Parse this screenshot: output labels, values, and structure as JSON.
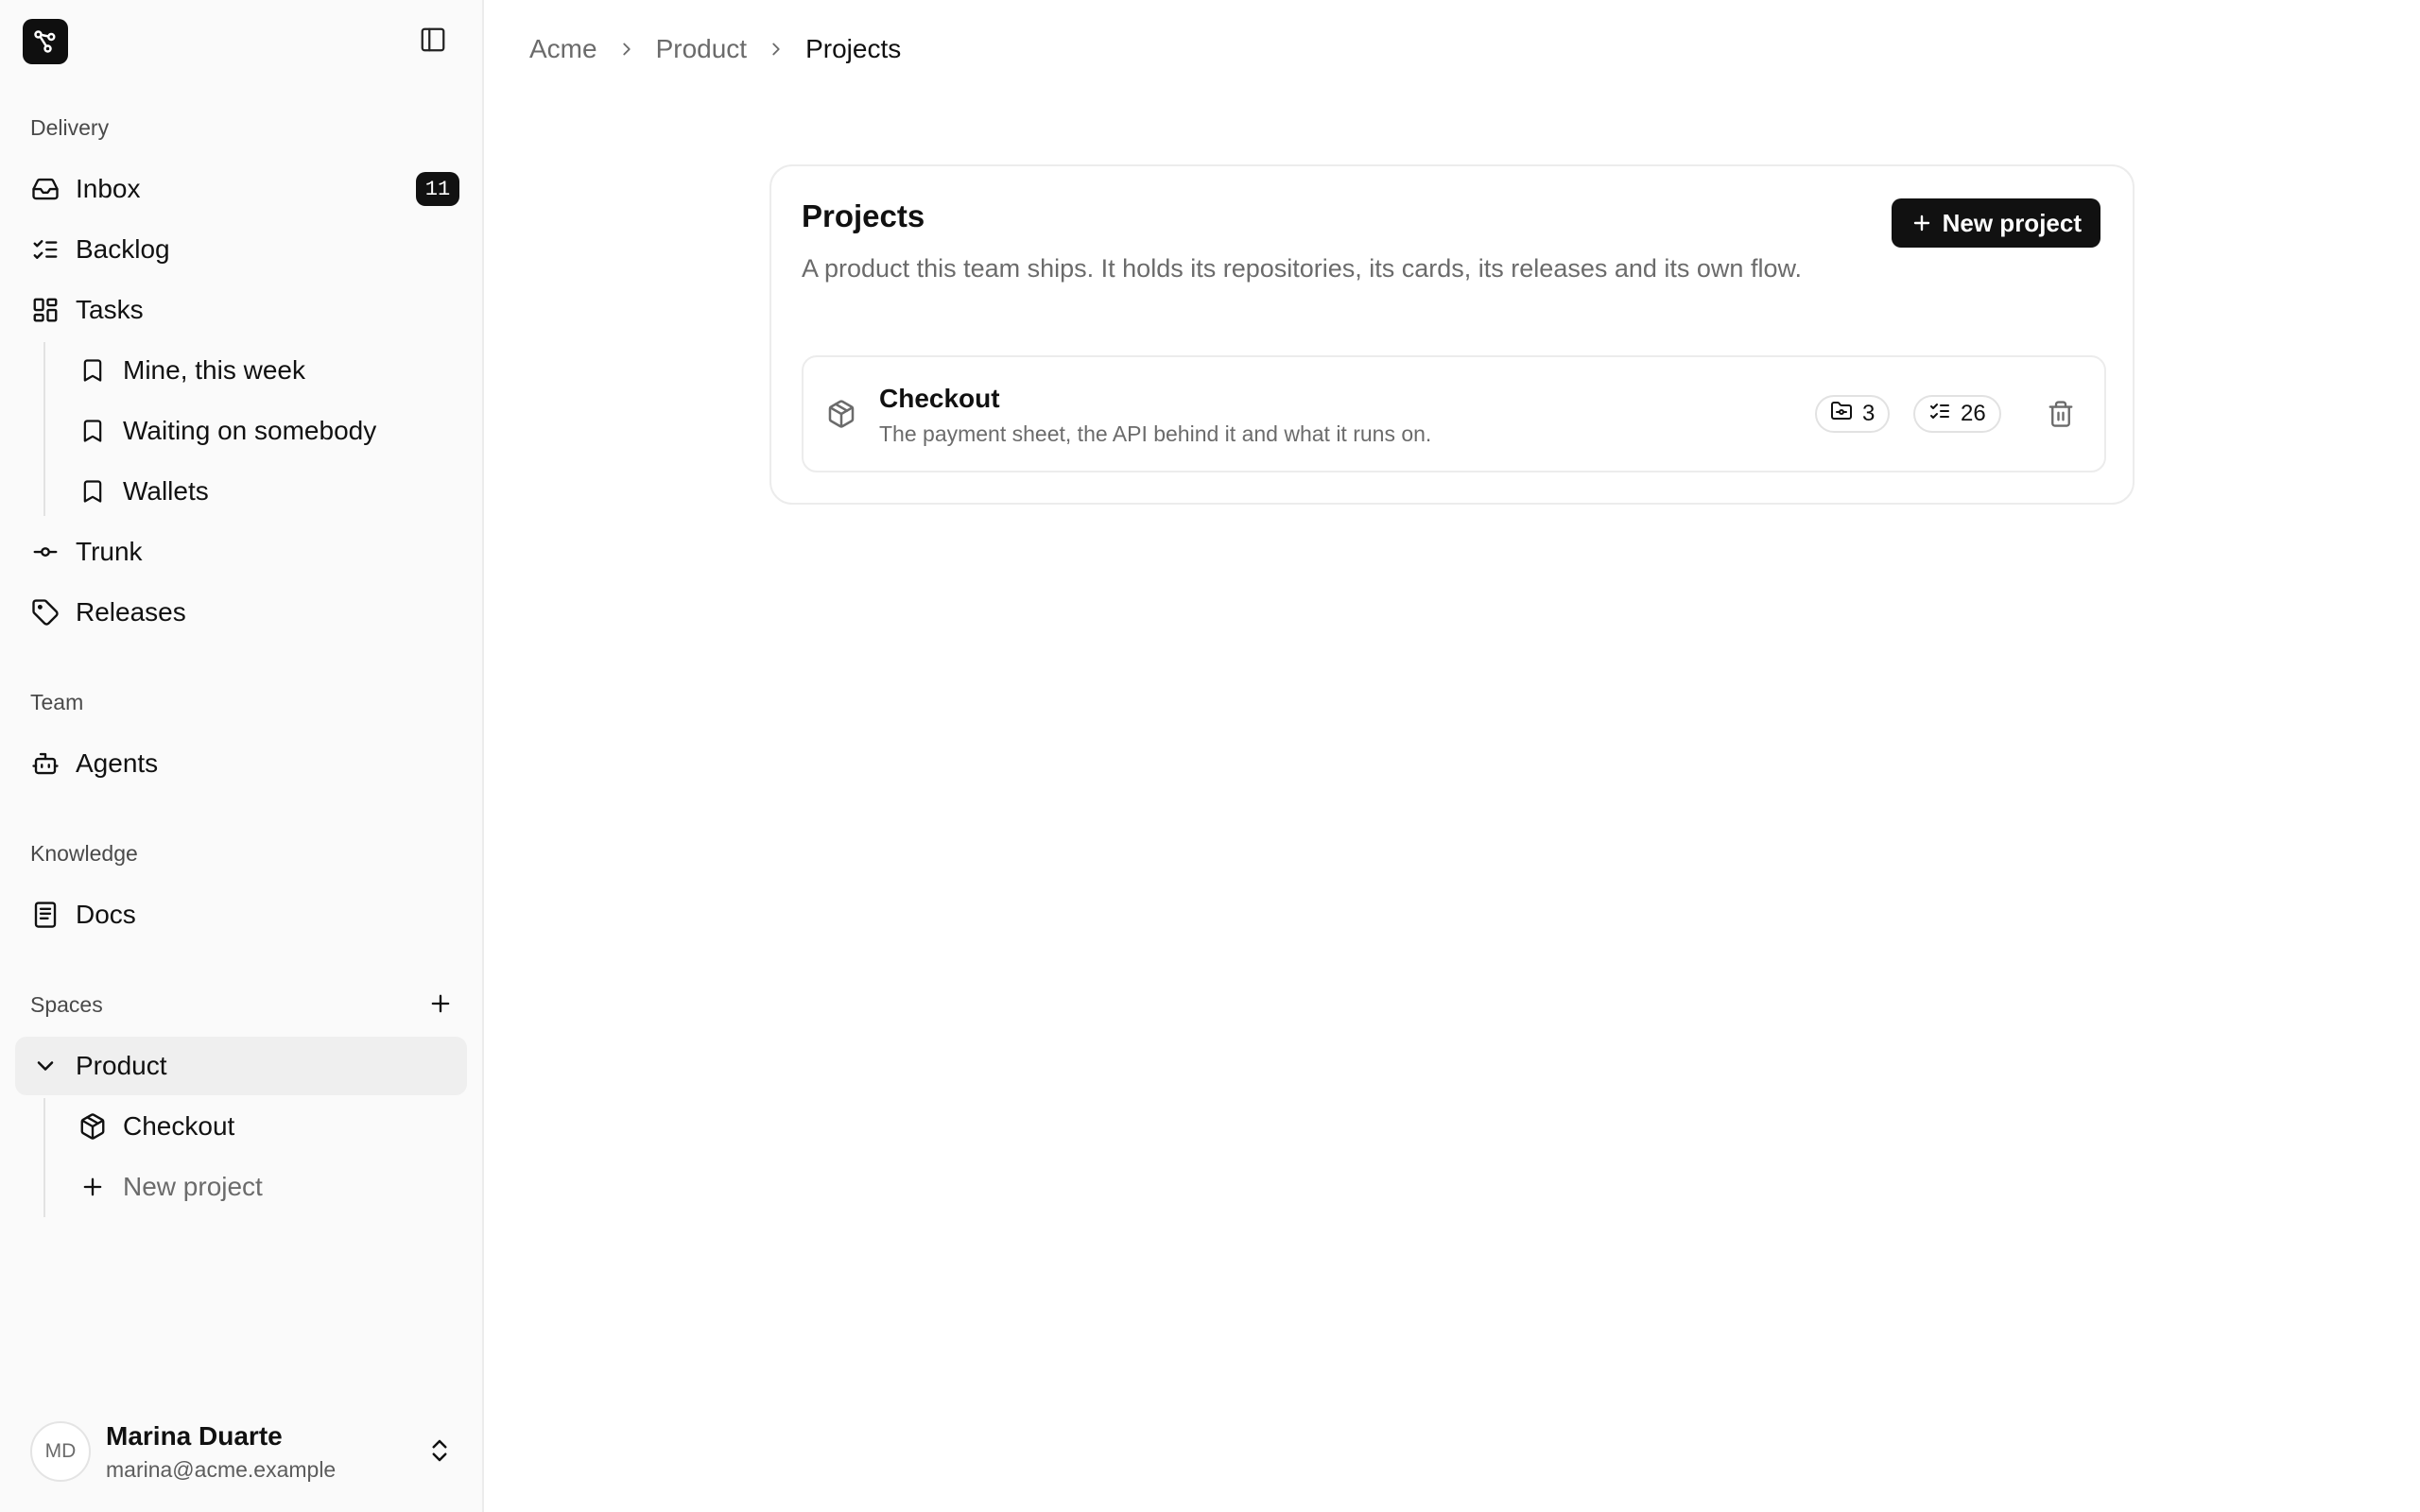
{
  "sidebar": {
    "logo_icon": "workflow-logo-icon",
    "toggle_icon": "sidebar-toggle-icon",
    "groups": {
      "delivery": "Delivery",
      "team": "Team",
      "knowledge": "Knowledge",
      "spaces": "Spaces"
    },
    "items": {
      "inbox": {
        "label": "Inbox",
        "badge": "11",
        "icon": "inbox-icon"
      },
      "backlog": {
        "label": "Backlog",
        "icon": "list-checks-icon"
      },
      "tasks": {
        "label": "Tasks",
        "icon": "layout-grid-icon"
      },
      "mine_this_week": {
        "label": "Mine, this week",
        "icon": "bookmark-icon"
      },
      "waiting": {
        "label": "Waiting on somebody",
        "icon": "bookmark-icon"
      },
      "wallets": {
        "label": "Wallets",
        "icon": "bookmark-icon"
      },
      "trunk": {
        "label": "Trunk",
        "icon": "git-commit-icon"
      },
      "releases": {
        "label": "Releases",
        "icon": "tag-icon"
      },
      "agents": {
        "label": "Agents",
        "icon": "bot-icon"
      },
      "docs": {
        "label": "Docs",
        "icon": "book-icon"
      },
      "product": {
        "label": "Product",
        "icon": "chevron-down-icon"
      },
      "checkout": {
        "label": "Checkout",
        "icon": "package-icon"
      },
      "new_project": {
        "label": "New project",
        "icon": "plus-icon"
      }
    },
    "user": {
      "initials": "MD",
      "name": "Marina Duarte",
      "email": "marina@acme.example"
    }
  },
  "breadcrumb": [
    "Acme",
    "Product",
    "Projects"
  ],
  "main": {
    "title": "Projects",
    "description": "A product this team ships. It holds its repositories, its cards, its releases and its own flow.",
    "new_button": "New project",
    "projects": [
      {
        "name": "Checkout",
        "description": "The payment sheet, the API behind it and what it runs on.",
        "repos": "3",
        "cards": "26"
      }
    ]
  },
  "colors": {
    "accent": "#111111",
    "sidebar_bg": "#fafafa",
    "muted_text": "#6b6b6b",
    "border": "#ececec"
  }
}
